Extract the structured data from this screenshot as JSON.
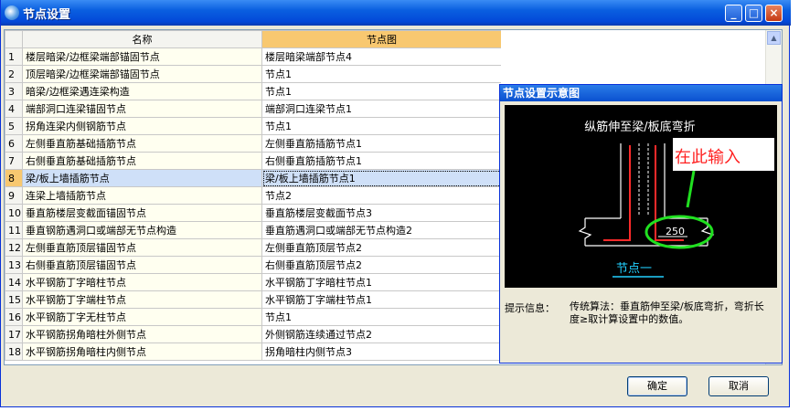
{
  "window": {
    "title": "节点设置",
    "minimize_glyph": "_",
    "maximize_glyph": "□",
    "close_glyph": "×"
  },
  "grid": {
    "columns": [
      "名称",
      "节点图"
    ],
    "selected_row": 8,
    "rows": [
      {
        "num": "1",
        "name": "楼层暗梁/边框梁端部锚固节点",
        "node": "楼层暗梁端部节点4"
      },
      {
        "num": "2",
        "name": "顶层暗梁/边框梁端部锚固节点",
        "node": "节点1"
      },
      {
        "num": "3",
        "name": "暗梁/边框梁遇连梁构造",
        "node": "节点1"
      },
      {
        "num": "4",
        "name": "端部洞口连梁锚固节点",
        "node": "端部洞口连梁节点1"
      },
      {
        "num": "5",
        "name": "拐角连梁内侧钢筋节点",
        "node": "节点1"
      },
      {
        "num": "6",
        "name": "左侧垂直筋基础插筋节点",
        "node": "左侧垂直筋插筋节点1"
      },
      {
        "num": "7",
        "name": "右侧垂直筋基础插筋节点",
        "node": "右侧垂直筋插筋节点1"
      },
      {
        "num": "8",
        "name": "梁/板上墙插筋节点",
        "node": "梁/板上墙插筋节点1"
      },
      {
        "num": "9",
        "name": "连梁上墙插筋节点",
        "node": "节点2"
      },
      {
        "num": "10",
        "name": "垂直筋楼层变截面锚固节点",
        "node": "垂直筋楼层变截面节点3"
      },
      {
        "num": "11",
        "name": "垂直钢筋遇洞口或端部无节点构造",
        "node": "垂直筋遇洞口或端部无节点构造2"
      },
      {
        "num": "12",
        "name": "左侧垂直筋顶层锚固节点",
        "node": "左侧垂直筋顶层节点2"
      },
      {
        "num": "13",
        "name": "右侧垂直筋顶层锚固节点",
        "node": "右侧垂直筋顶层节点2"
      },
      {
        "num": "14",
        "name": "水平钢筋丁字暗柱节点",
        "node": "水平钢筋丁字暗柱节点1"
      },
      {
        "num": "15",
        "name": "水平钢筋丁字端柱节点",
        "node": "水平钢筋丁字端柱节点1"
      },
      {
        "num": "16",
        "name": "水平钢筋丁字无柱节点",
        "node": "节点1"
      },
      {
        "num": "17",
        "name": "水平钢筋拐角暗柱外侧节点",
        "node": "外侧钢筋连续通过节点2"
      },
      {
        "num": "18",
        "name": "水平钢筋拐角暗柱内侧节点",
        "node": "拐角暗柱内侧节点3"
      }
    ]
  },
  "panel": {
    "title": "节点设置示意图",
    "diagram": {
      "caption": "纵筋伸至梁/板底弯折",
      "callout": "在此输入",
      "dimension_value": "250",
      "node_label": "节点一"
    },
    "hint_label": "提示信息：",
    "hint_text": "传统算法：垂直筋伸至梁/板底弯折，弯折长度≥取计算设置中的数值。"
  },
  "buttons": {
    "ok": "确定",
    "cancel": "取消"
  },
  "colors": {
    "accent_title": "#0a5fe0",
    "selected_header": "#f8c870",
    "selected_row": "#cfe0f8",
    "callout_red": "#ff2020",
    "circle_green": "#20e020",
    "label_cyan": "#22d0ff"
  }
}
